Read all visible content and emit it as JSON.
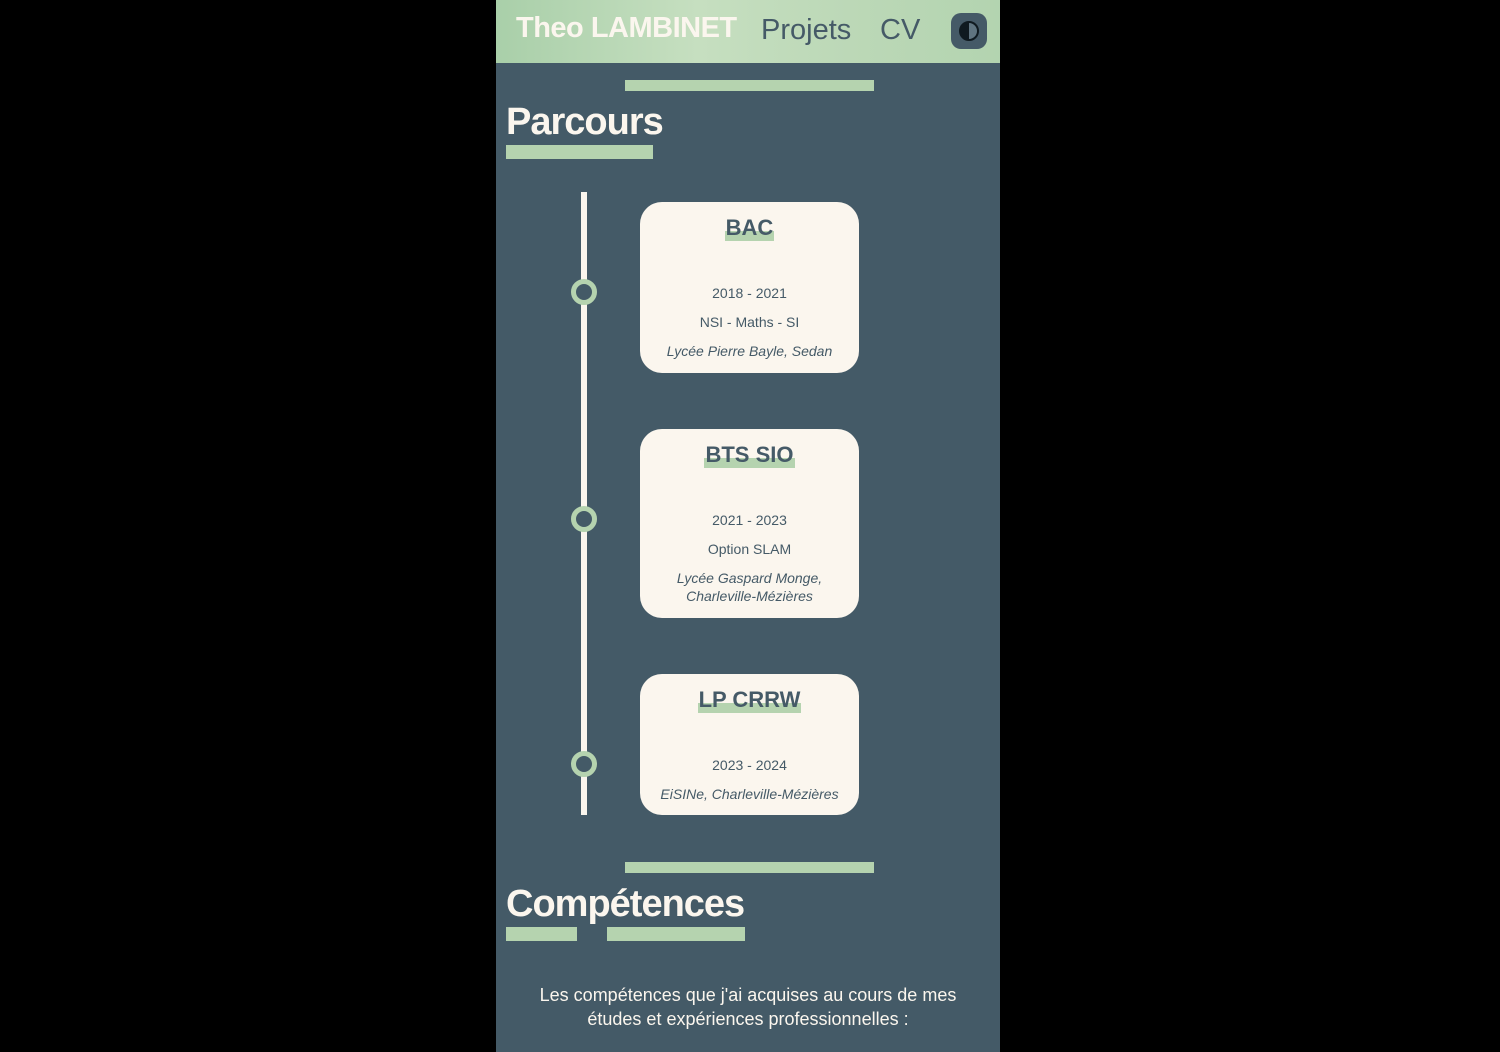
{
  "header": {
    "brand": "Theo LAMBINET",
    "nav": [
      {
        "label": "Projets"
      },
      {
        "label": "CV"
      }
    ],
    "theme_toggle_icon": "contrast-icon"
  },
  "parcours": {
    "title": "Parcours",
    "items": [
      {
        "title": "BAC",
        "dates": "2018 - 2021",
        "detail": "NSI - Maths - SI",
        "place": "Lycée Pierre Bayle, Sedan"
      },
      {
        "title": "BTS SIO",
        "dates": "2021 - 2023",
        "detail": "Option SLAM",
        "place": "Lycée Gaspard Monge, Charleville-Mézières"
      },
      {
        "title": "LP CRRW",
        "dates": "2023 - 2024",
        "detail": "",
        "place": "EiSINe, Charleville-Mézières"
      }
    ]
  },
  "competences": {
    "title": "Compétences",
    "intro": "Les compétences que j'ai acquises au cours de mes études et expériences professionnelles :"
  },
  "colors": {
    "background": "#445a67",
    "accent": "#b5d3af",
    "card": "#fbf6ee"
  }
}
